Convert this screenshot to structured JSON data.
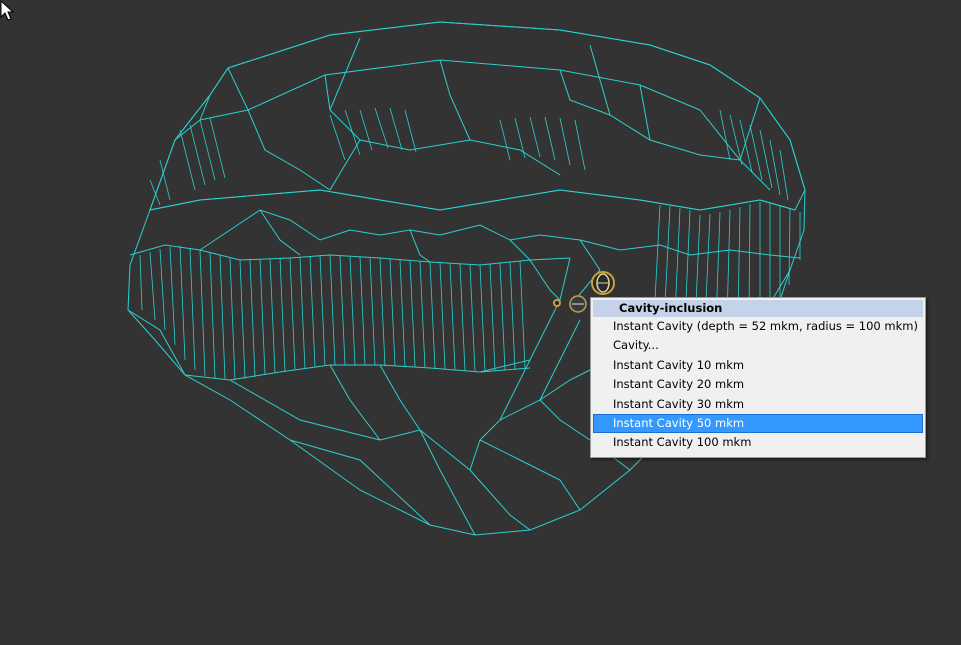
{
  "colors": {
    "background": "#333333",
    "wireframe": "#2bd1cf",
    "menu_background": "#f0f0f0",
    "menu_header": "#c5d3ea",
    "menu_selected": "#3399ff"
  },
  "viewport": {
    "model": "diamond-wireframe",
    "markers": [
      "inclusion-marker-icon",
      "cavity-marker-icon"
    ]
  },
  "context_menu": {
    "header": "Cavity-inclusion",
    "items": [
      "Instant Cavity (depth = 52 mkm, radius = 100 mkm)",
      "Cavity...",
      "Instant Cavity 10 mkm",
      "Instant Cavity 20 mkm",
      "Instant Cavity 30 mkm",
      "Instant Cavity 50 mkm",
      "Instant Cavity 100 mkm"
    ],
    "selected_index": 5
  },
  "cursor": "arrow-cursor-icon"
}
